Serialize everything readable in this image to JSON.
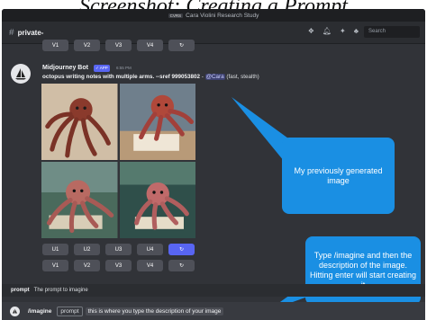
{
  "caption": "Screenshot: Creating a Prompt",
  "window": {
    "title": "Cara Violini Research Study"
  },
  "channel": {
    "hash": "#",
    "name": "private-"
  },
  "header_icons": [
    "threads-icon",
    "bell-icon",
    "pin-icon",
    "members-icon"
  ],
  "search": {
    "placeholder": "Search"
  },
  "top_buttons": [
    "V1",
    "V2",
    "V3",
    "V4",
    "↻"
  ],
  "message": {
    "author": "Midjourney Bot",
    "bot_tag": "✓ APP",
    "timestamp": "6:55 PM",
    "prompt_text": "octopus writing notes with multiple arms. --sref 999053802",
    "separator": " - ",
    "mention": "@Cara",
    "suffix": " (fast, stealth)"
  },
  "upscale_buttons": [
    "U1",
    "U2",
    "U3",
    "U4",
    "↻"
  ],
  "variation_buttons": [
    "V1",
    "V2",
    "V3",
    "V4",
    "↻"
  ],
  "callouts": {
    "generated": "My previously generated image",
    "imagine": "Type /imagine and then the description of the image. Hitting enter will start creating it"
  },
  "hint": {
    "key": "prompt",
    "text": "The prompt to imagine"
  },
  "input": {
    "command": "/imagine",
    "option": "prompt",
    "value": "this is where you type the description of your image"
  },
  "colors": {
    "discord_bg": "#313338",
    "button_gray": "#4e5058",
    "blurple": "#5865f2",
    "callout_blue": "#1a8fe3"
  }
}
